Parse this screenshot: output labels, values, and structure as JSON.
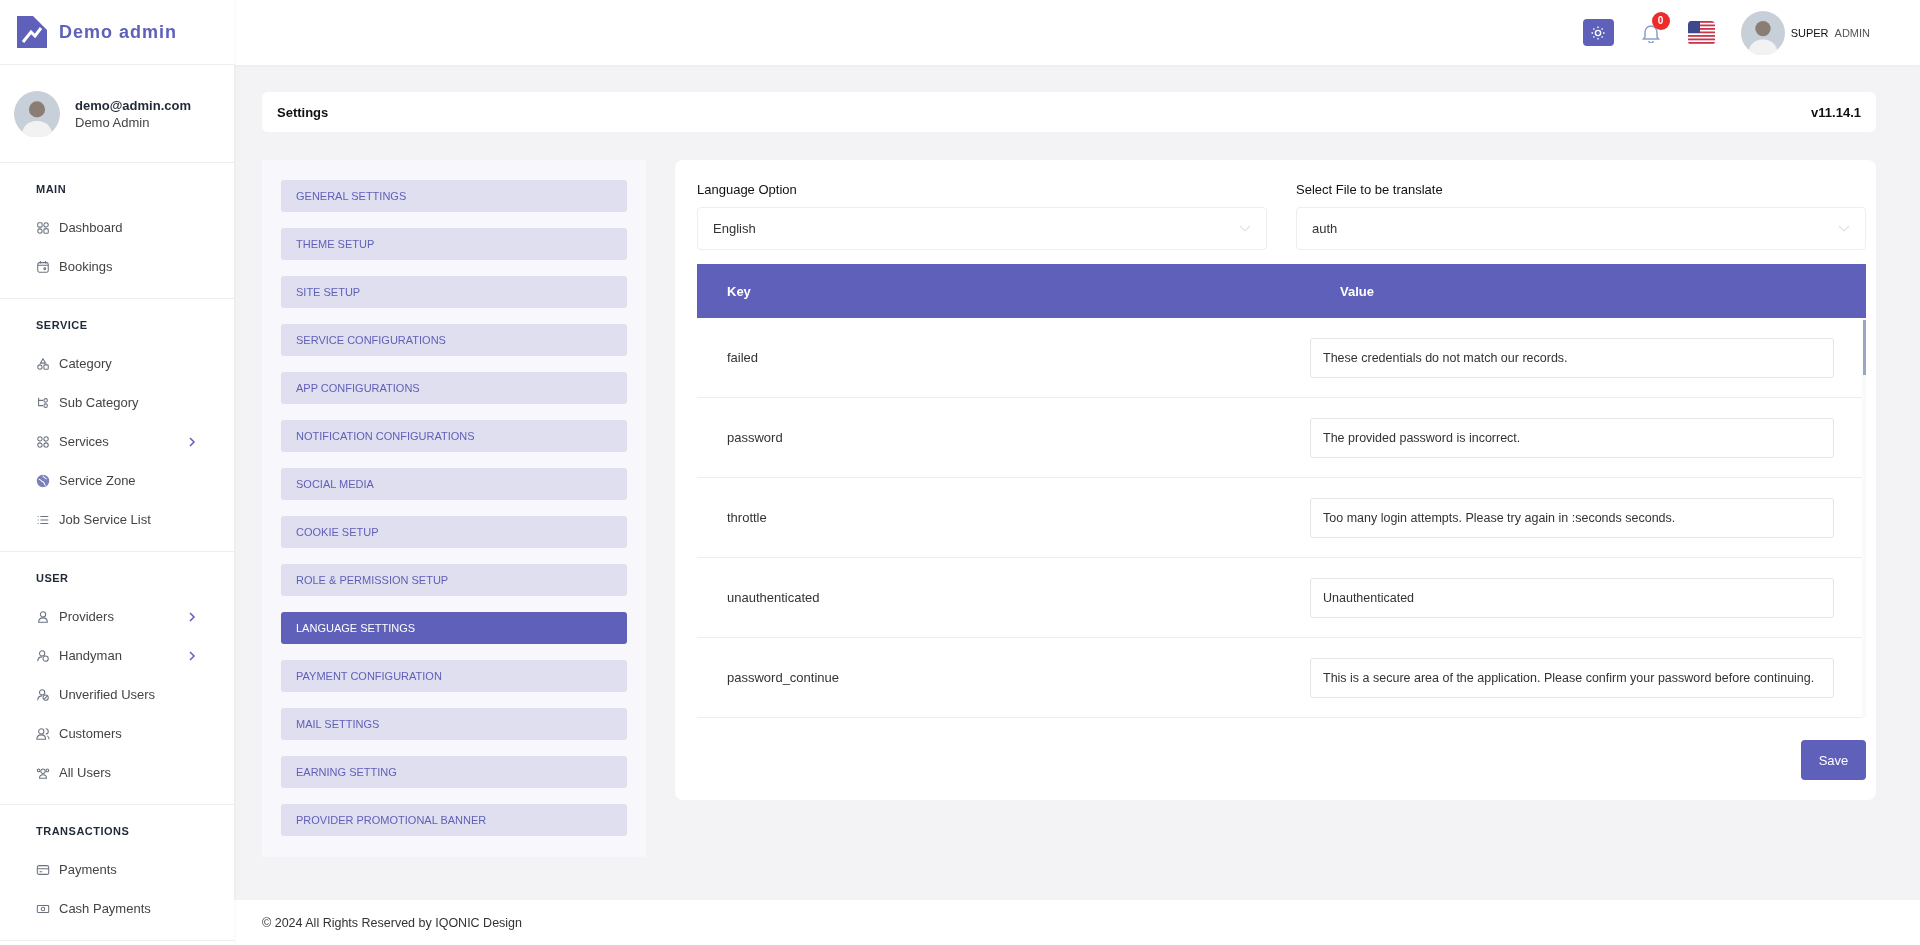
{
  "brand": {
    "name": "Demo admin"
  },
  "profile": {
    "email": "demo@admin.com",
    "role": "Demo Admin"
  },
  "sidebar": {
    "sections": [
      {
        "title": "MAIN",
        "items": [
          {
            "label": "Dashboard",
            "has_submenu": false
          },
          {
            "label": "Bookings",
            "has_submenu": false
          }
        ]
      },
      {
        "title": "SERVICE",
        "items": [
          {
            "label": "Category",
            "has_submenu": false
          },
          {
            "label": "Sub Category",
            "has_submenu": false
          },
          {
            "label": "Services",
            "has_submenu": true
          },
          {
            "label": "Service Zone",
            "has_submenu": false
          },
          {
            "label": "Job Service List",
            "has_submenu": false
          }
        ]
      },
      {
        "title": "USER",
        "items": [
          {
            "label": "Providers",
            "has_submenu": true
          },
          {
            "label": "Handyman",
            "has_submenu": true
          },
          {
            "label": "Unverified Users",
            "has_submenu": false
          },
          {
            "label": "Customers",
            "has_submenu": false
          },
          {
            "label": "All Users",
            "has_submenu": false
          }
        ]
      },
      {
        "title": "TRANSACTIONS",
        "items": [
          {
            "label": "Payments",
            "has_submenu": false
          },
          {
            "label": "Cash Payments",
            "has_submenu": false
          }
        ]
      }
    ]
  },
  "topbar": {
    "notification_count": "0",
    "user_first": "SUPER",
    "user_last": "ADMIN"
  },
  "page_header": {
    "title": "Settings",
    "version": "v11.14.1"
  },
  "settings_menu": [
    {
      "label": "GENERAL SETTINGS",
      "selected": false
    },
    {
      "label": "THEME SETUP",
      "selected": false
    },
    {
      "label": "SITE SETUP",
      "selected": false
    },
    {
      "label": "SERVICE CONFIGURATIONS",
      "selected": false
    },
    {
      "label": "APP CONFIGURATIONS",
      "selected": false
    },
    {
      "label": "NOTIFICATION CONFIGURATIONS",
      "selected": false
    },
    {
      "label": "SOCIAL MEDIA",
      "selected": false
    },
    {
      "label": "COOKIE SETUP",
      "selected": false
    },
    {
      "label": "ROLE & PERMISSION SETUP",
      "selected": false
    },
    {
      "label": "LANGUAGE SETTINGS",
      "selected": true
    },
    {
      "label": "PAYMENT CONFIGURATION",
      "selected": false
    },
    {
      "label": "MAIL SETTINGS",
      "selected": false
    },
    {
      "label": "EARNING SETTING",
      "selected": false
    },
    {
      "label": "PROVIDER PROMOTIONAL BANNER",
      "selected": false
    }
  ],
  "language_panel": {
    "language_label": "Language Option",
    "language_value": "English",
    "file_label": "Select File to be translate",
    "file_value": "auth",
    "table": {
      "columns": [
        "Key",
        "Value"
      ],
      "rows": [
        {
          "key": "failed",
          "value": "These credentials do not match our records."
        },
        {
          "key": "password",
          "value": "The provided password is incorrect."
        },
        {
          "key": "throttle",
          "value": "Too many login attempts. Please try again in :seconds seconds."
        },
        {
          "key": "unauthenticated",
          "value": "Unauthenticated"
        },
        {
          "key": "password_continue",
          "value": "This is a secure area of the application. Please confirm your password before continuing."
        }
      ]
    },
    "save_button": "Save"
  },
  "footer": {
    "text": "© 2024 All Rights Reserved by IQONIC Design"
  }
}
